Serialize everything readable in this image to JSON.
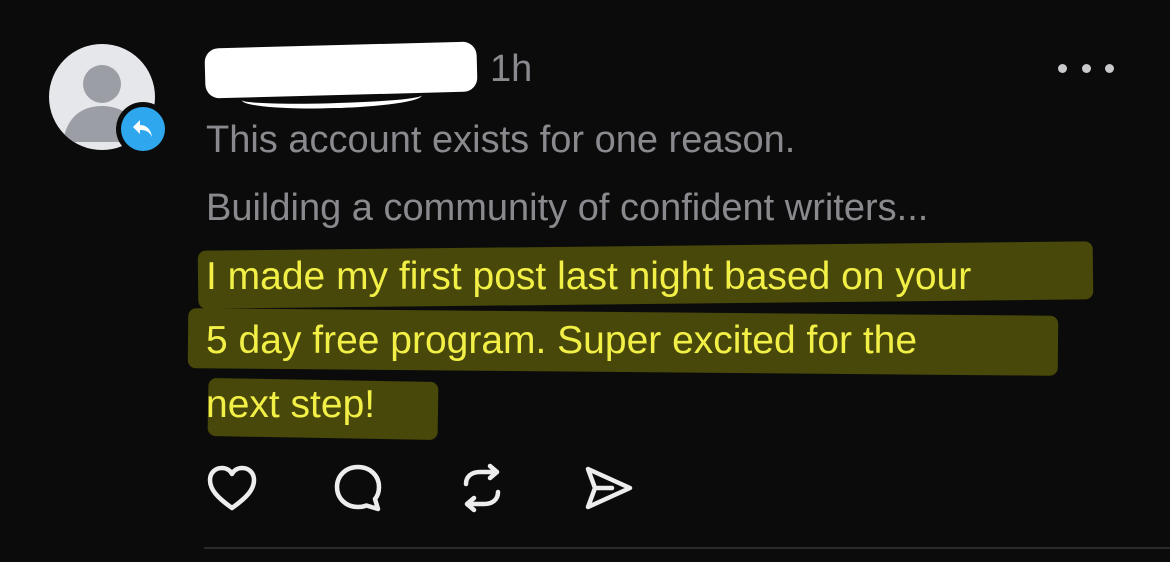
{
  "post": {
    "time": "1h",
    "bio_line_1": "This account exists for one reason.",
    "bio_line_2": "Building a community of confident writers...",
    "body_lines": [
      "I made my first post last night based on your",
      "5 day free program. Super excited for the",
      "next step!"
    ]
  },
  "actions": {
    "like_icon": "heart-icon",
    "comment_icon": "comment-bubble-icon",
    "repost_icon": "repost-icon",
    "share_icon": "send-icon"
  },
  "colors": {
    "background": "#0b0b0b",
    "secondary_text": "#8a8a8e",
    "highlight_text": "#f2ef46",
    "reply_badge": "#2ea7ee"
  }
}
